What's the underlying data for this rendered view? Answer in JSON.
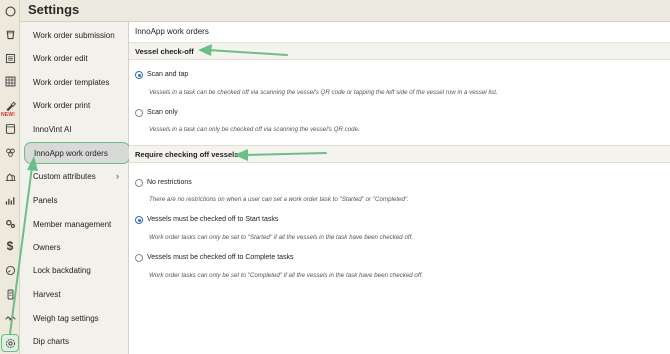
{
  "header": {
    "title": "Settings"
  },
  "rail": {
    "icons": [
      "circle-icon",
      "bucket-icon",
      "list-icon",
      "grid-icon",
      "paint-icon",
      "barrel-icon",
      "cluster-icon",
      "flask-icon",
      "chart-icon",
      "gears-icon",
      "dollar-icon",
      "gauge-icon",
      "battery-icon",
      "scale-icon",
      "gear-icon"
    ],
    "new_badge": "NEW!"
  },
  "nav": {
    "items": [
      {
        "label": "Work order submission"
      },
      {
        "label": "Work order edit"
      },
      {
        "label": "Work order templates"
      },
      {
        "label": "Work order print"
      },
      {
        "label": "InnoVint AI"
      },
      {
        "label": "InnoApp work orders"
      },
      {
        "label": "Custom attributes"
      },
      {
        "label": "Panels"
      },
      {
        "label": "Member management"
      },
      {
        "label": "Owners"
      },
      {
        "label": "Lock backdating"
      },
      {
        "label": "Harvest"
      },
      {
        "label": "Weigh tag settings"
      },
      {
        "label": "Dip charts"
      }
    ]
  },
  "main": {
    "title": "InnoApp work orders",
    "vessel_checkoff": {
      "heading": "Vessel check-off",
      "options": [
        {
          "label": "Scan and tap",
          "desc": "Vessels in a task can be checked off via scanning the vessel's QR code or tapping the left side of the vessel row in a vessel list.",
          "checked": true
        },
        {
          "label": "Scan only",
          "desc": "Vessels in a task can only be checked off via scanning the vessel's QR code.",
          "checked": false
        }
      ]
    },
    "require_checking": {
      "heading": "Require checking off vessels",
      "options": [
        {
          "label": "No restrictions",
          "desc": "There are no restrictions on when a user can set a work order task to \"Started\" or \"Completed\".",
          "checked": false
        },
        {
          "label": "Vessels must be checked off to Start tasks",
          "desc": "Work order tasks can only be set to \"Started\" if all the vessels in the task have been checked off.",
          "checked": true
        },
        {
          "label": "Vessels must be checked off to Complete tasks",
          "desc": "Work order tasks can only be set to \"Completed\" if all the vessels in the task have been checked off.",
          "checked": false
        }
      ]
    }
  },
  "colors": {
    "accent": "#6bbf86",
    "radio": "#2f6fb6",
    "badge": "#d0342c"
  }
}
